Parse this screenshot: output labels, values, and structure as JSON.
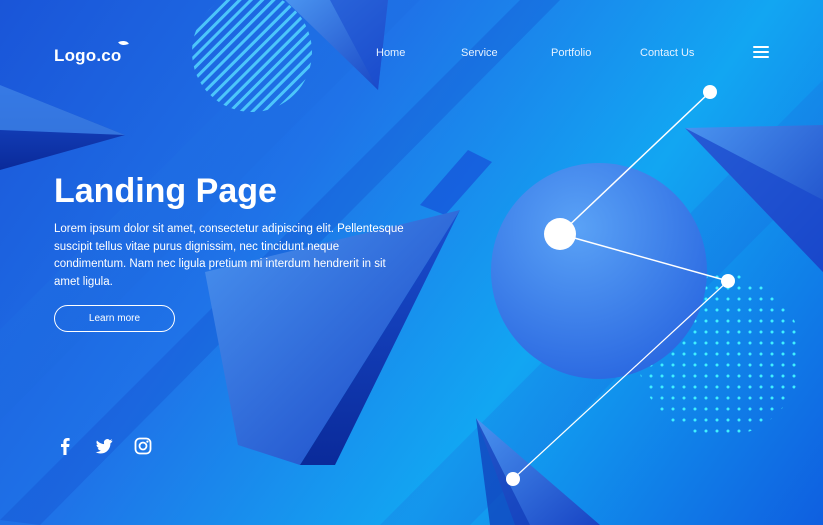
{
  "header": {
    "logo_text": "Logo.co",
    "nav": [
      "Home",
      "Service",
      "Portfolio",
      "Contact Us"
    ],
    "menu_icon": "hamburger-menu-icon"
  },
  "hero": {
    "title": "Landing Page",
    "body": "Lorem ipsum dolor sit amet, consectetur adipiscing elit. Pellentesque suscipit tellus vitae purus dignissim, nec tincidunt neque condimentum. Nam nec ligula pretium mi interdum hendrerit in sit amet ligula.",
    "cta_label": "Learn more"
  },
  "social": [
    "facebook-icon",
    "twitter-icon",
    "instagram-icon"
  ],
  "colors": {
    "background_start": "#1a55d8",
    "background_mid": "#12a6f2",
    "circle": "#3a86f0",
    "dots": "#3ff0ff",
    "text": "#ffffff"
  }
}
